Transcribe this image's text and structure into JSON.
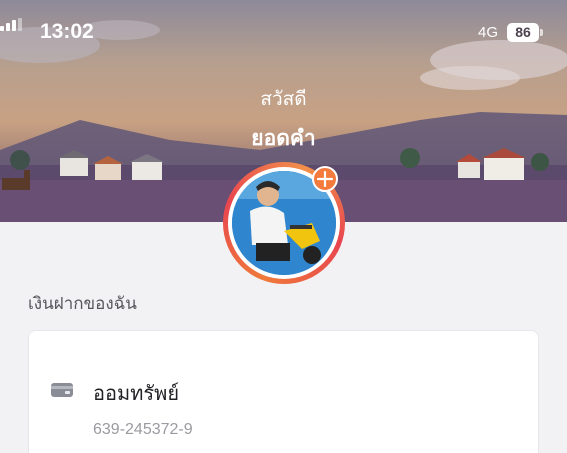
{
  "status_bar": {
    "time": "13:02",
    "network": "4G",
    "battery": "86"
  },
  "header": {
    "greeting": "สวัสดี",
    "user_name": "ยอดคำ"
  },
  "section": {
    "title": "เงินฝากของฉัน"
  },
  "account": {
    "name": "ออมทรัพย์",
    "number": "639-245372-9",
    "icon": "wallet-icon"
  },
  "colors": {
    "avatar_ring": "#e8454f",
    "badge": "#f47a3d",
    "page_bg": "#f2f2f4"
  }
}
